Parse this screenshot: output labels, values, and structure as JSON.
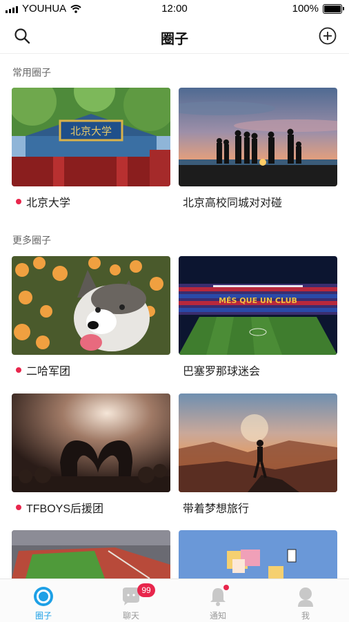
{
  "status_bar": {
    "carrier": "YOUHUA",
    "time": "12:00",
    "battery": "100%"
  },
  "header": {
    "title": "圈子"
  },
  "sections": {
    "common": {
      "label": "常用圈子"
    },
    "more": {
      "label": "更多圈子"
    }
  },
  "circles": [
    {
      "name": "北京大学",
      "unread": true
    },
    {
      "name": "北京高校同城对对碰",
      "unread": false
    },
    {
      "name": "二哈军团",
      "unread": true
    },
    {
      "name": "巴塞罗那球迷会",
      "unread": false
    },
    {
      "name": "TFBOYS后援团",
      "unread": true
    },
    {
      "name": "带着梦想旅行",
      "unread": false
    }
  ],
  "tabs": [
    {
      "label": "圈子",
      "active": true
    },
    {
      "label": "聊天",
      "badge": "99"
    },
    {
      "label": "通知",
      "dot": true
    },
    {
      "label": "我"
    }
  ],
  "colors": {
    "accent": "#1ea0e6",
    "badge": "#e8264c"
  }
}
